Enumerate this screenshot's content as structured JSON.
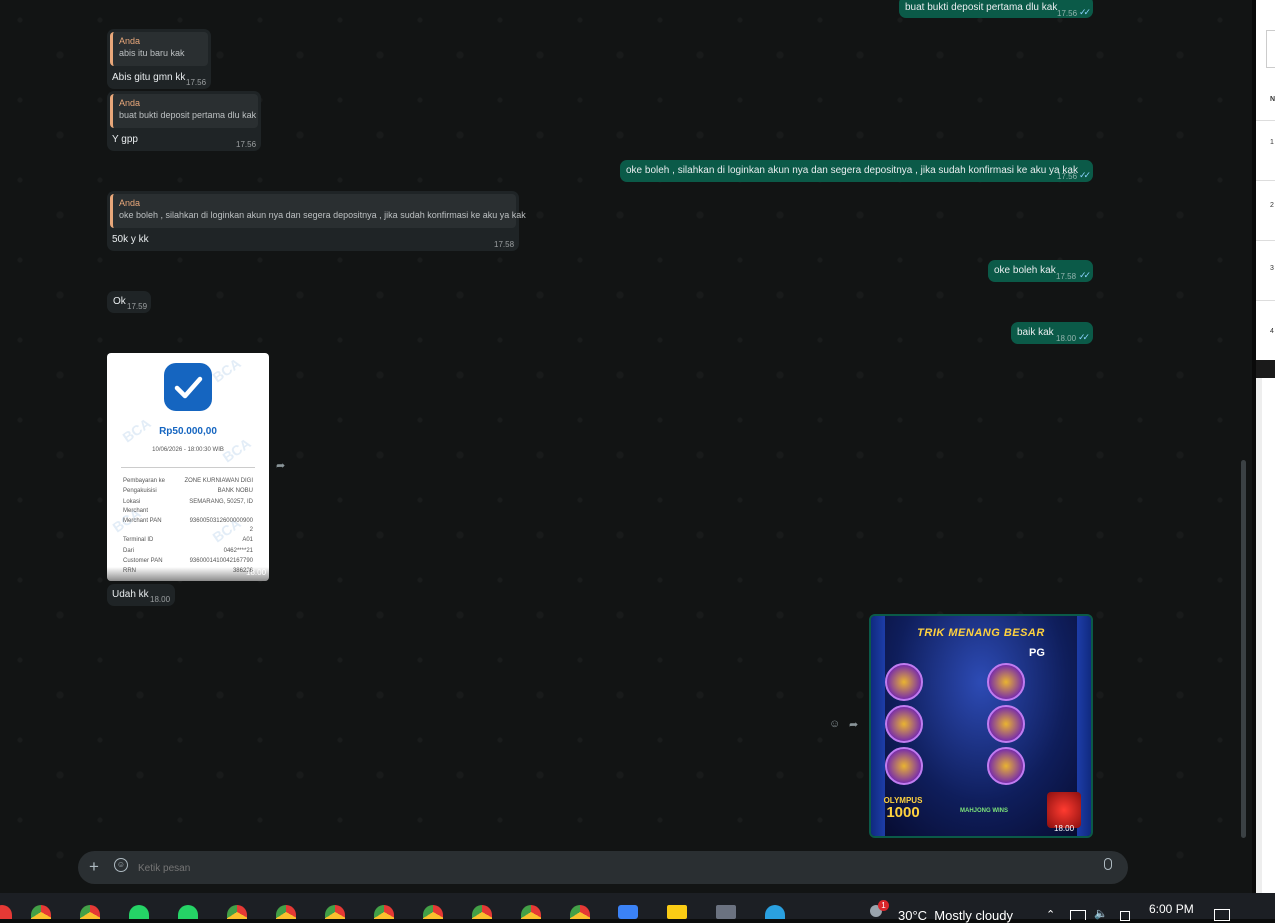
{
  "messages": {
    "m1": {
      "text": "buat bukti deposit pertama dlu kak",
      "time": "17.56"
    },
    "m2": {
      "quote_author": "Anda",
      "quote_text": "abis itu baru kak",
      "text": "Abis gitu gmn kk",
      "time": "17.56"
    },
    "m3": {
      "quote_author": "Anda",
      "quote_text": "buat bukti deposit pertama dlu kak",
      "text": "Y gpp",
      "time": "17.56"
    },
    "m4": {
      "text": "oke boleh , silahkan di loginkan akun nya dan segera depositnya , jika sudah konfirmasi ke aku ya kak",
      "time": "17.56"
    },
    "m5": {
      "quote_author": "Anda",
      "quote_text": "oke boleh , silahkan di loginkan akun nya dan segera depositnya , jika sudah konfirmasi ke aku ya kak",
      "text": "50k y kk",
      "time": "17.58"
    },
    "m6": {
      "text": "oke boleh kak",
      "time": "17.58"
    },
    "m7": {
      "text": "Ok",
      "time": "17.59"
    },
    "m8": {
      "text": "baik kak",
      "time": "18.00"
    },
    "m9": {
      "text": "Udah kk",
      "time": "18.00"
    },
    "receipt": {
      "watermark": "BCA",
      "amount": "Rp50.000,00",
      "datetime": "10/06/2026 - 18:00:30 WIB",
      "rows": [
        {
          "label": "Pembayaran ke",
          "value": "ZONE KURNIAWAN DIGI"
        },
        {
          "label": "Pengakuisisi",
          "value": "BANK NOBU"
        },
        {
          "label": "Lokasi",
          "value": "SEMARANG, 50257, ID"
        },
        {
          "label": "Merchant",
          "value": ""
        },
        {
          "label": "Merchant PAN",
          "value": "9360050312600000900"
        },
        {
          "label": "",
          "value": "2"
        },
        {
          "label": "Terminal ID",
          "value": "A01"
        },
        {
          "label": "Dari",
          "value": "0462****21"
        },
        {
          "label": "Customer PAN",
          "value": "9360001410042167790"
        },
        {
          "label": "RRN",
          "value": "386236"
        }
      ],
      "time": "18.00"
    },
    "promo": {
      "title": "TRIK MENANG BESAR",
      "brand": "PG",
      "bottom_left": "OLYMPUS",
      "bottom_left_num": "1000",
      "bottom_mid": "MAHJONG WINS",
      "time": "18.00"
    }
  },
  "composer": {
    "placeholder": "Ketik pesan"
  },
  "taskbar": {
    "weather": "30°C  Mostly cloudy",
    "clock": "6:00 PM",
    "notification_count": "1"
  },
  "right_panel": {
    "labels": [
      "N",
      "1",
      "2",
      "3",
      "4"
    ]
  },
  "colors": {
    "outgoing": "#0b5a48",
    "incoming": "#1f2426",
    "quote_accent": "#e8a77a",
    "tick": "#8bd3ff"
  }
}
